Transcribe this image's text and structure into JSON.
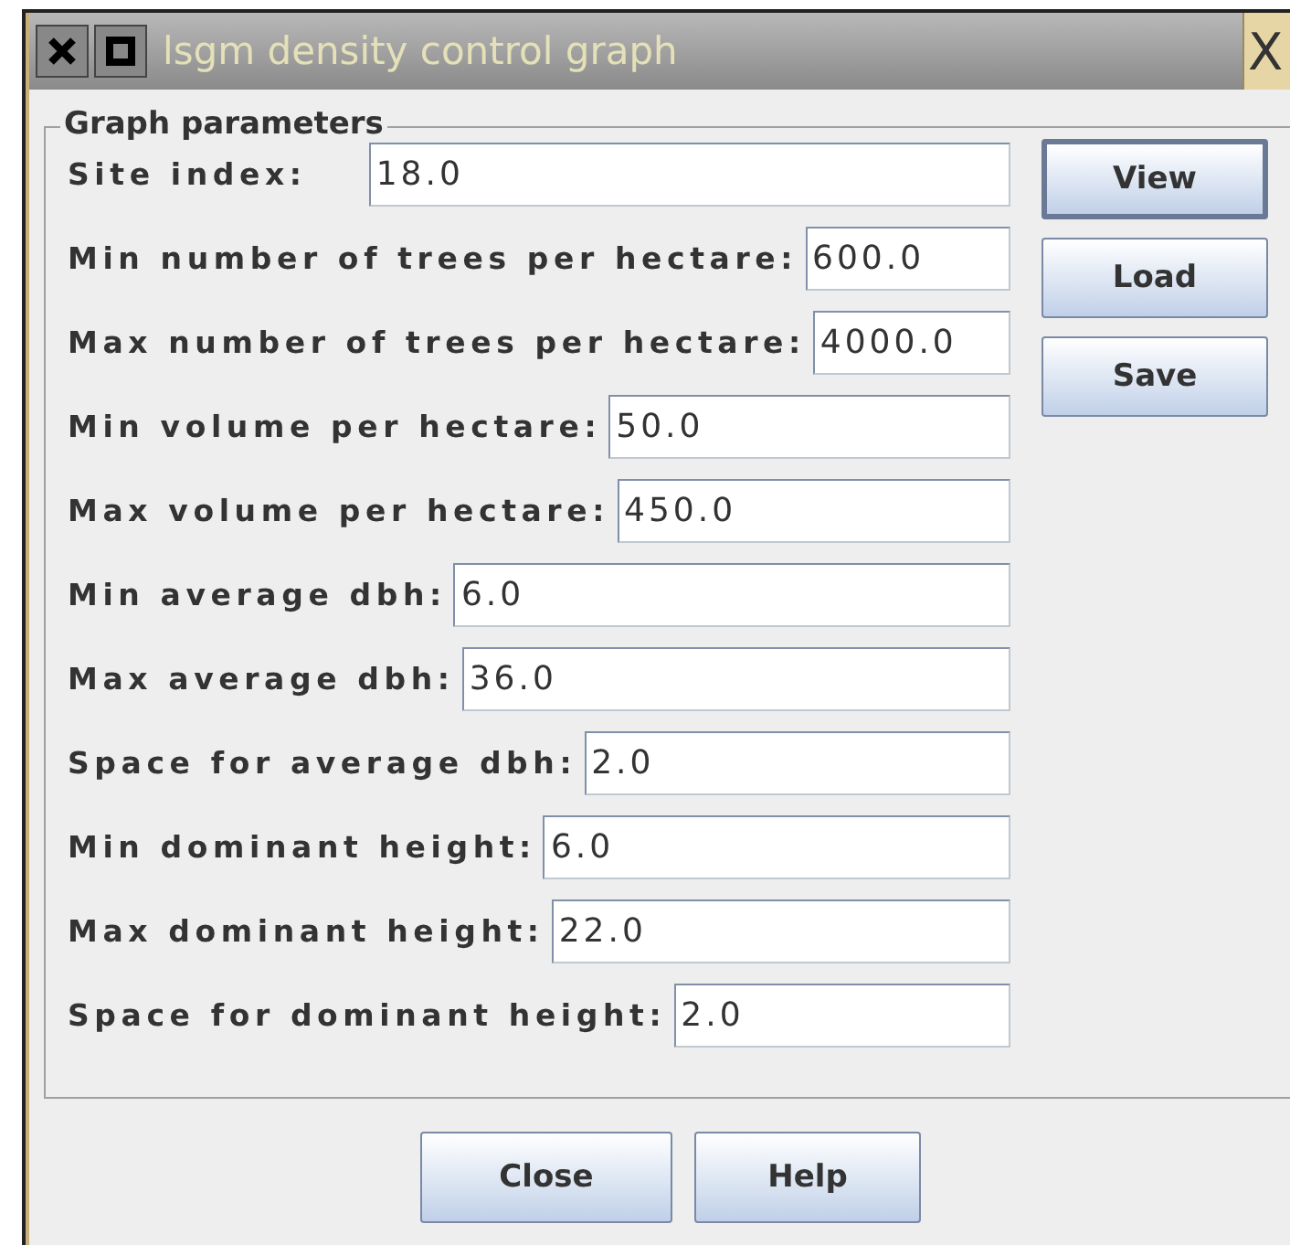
{
  "window": {
    "title": "lsgm density control graph",
    "close_glyph": "X"
  },
  "group": {
    "title": "Graph parameters"
  },
  "fields": [
    {
      "label": "Site index:",
      "value": "18.0"
    },
    {
      "label": "Min number of trees per hectare:",
      "value": "600.0"
    },
    {
      "label": "Max number of trees per hectare:",
      "value": "4000.0"
    },
    {
      "label": "Min volume per hectare:",
      "value": "50.0"
    },
    {
      "label": "Max volume per hectare:",
      "value": "450.0"
    },
    {
      "label": "Min average dbh:",
      "value": "6.0"
    },
    {
      "label": "Max average dbh:",
      "value": "36.0"
    },
    {
      "label": "Space for average dbh:",
      "value": "2.0"
    },
    {
      "label": "Min dominant height:",
      "value": "6.0"
    },
    {
      "label": "Max dominant height:",
      "value": "22.0"
    },
    {
      "label": "Space for dominant height:",
      "value": "2.0"
    }
  ],
  "side_buttons": [
    {
      "label": "View",
      "focused": true
    },
    {
      "label": "Load",
      "focused": false
    },
    {
      "label": "Save",
      "focused": false
    }
  ],
  "bottom_buttons": [
    "Close",
    "Help"
  ]
}
